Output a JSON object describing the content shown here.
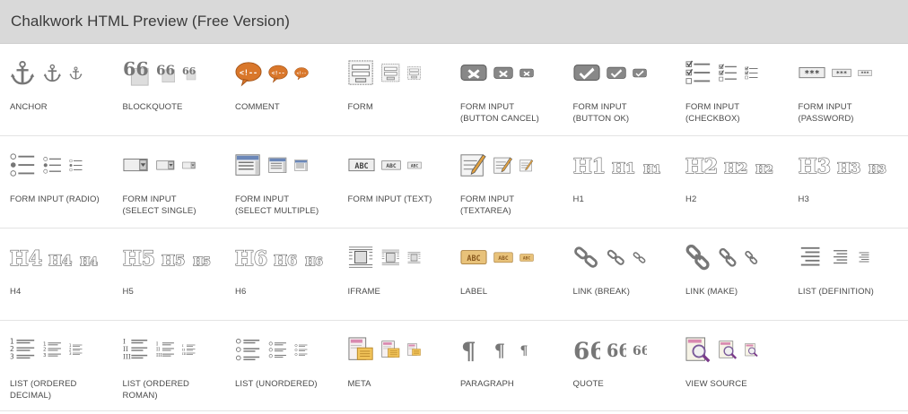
{
  "window": {
    "title": "Chalkwork HTML Preview (Free Version)"
  },
  "rows": [
    [
      {
        "label": "ANCHOR",
        "icon": "anchor-icon"
      },
      {
        "label": "BLOCKQUOTE",
        "icon": "blockquote-icon"
      },
      {
        "label": "COMMENT",
        "icon": "comment-icon"
      },
      {
        "label": "FORM",
        "icon": "form-icon"
      },
      {
        "label": "FORM INPUT\n(BUTTON CANCEL)",
        "icon": "button-cancel-icon"
      },
      {
        "label": "FORM INPUT\n(BUTTON OK)",
        "icon": "button-ok-icon"
      },
      {
        "label": "FORM INPUT\n(CHECKBOX)",
        "icon": "checkbox-icon"
      },
      {
        "label": "FORM INPUT\n(PASSWORD)",
        "icon": "password-icon"
      }
    ],
    [
      {
        "label": "FORM INPUT (RADIO)",
        "icon": "radio-icon"
      },
      {
        "label": "FORM INPUT\n(SELECT SINGLE)",
        "icon": "select-single-icon"
      },
      {
        "label": "FORM INPUT\n(SELECT MULTIPLE)",
        "icon": "select-multiple-icon"
      },
      {
        "label": "FORM INPUT (TEXT)",
        "icon": "text-input-icon"
      },
      {
        "label": "FORM INPUT\n(TEXTAREA)",
        "icon": "textarea-icon"
      },
      {
        "label": "H1",
        "icon": "h1-icon"
      },
      {
        "label": "H2",
        "icon": "h2-icon"
      },
      {
        "label": "H3",
        "icon": "h3-icon"
      }
    ],
    [
      {
        "label": "H4",
        "icon": "h4-icon"
      },
      {
        "label": "H5",
        "icon": "h5-icon"
      },
      {
        "label": "H6",
        "icon": "h6-icon"
      },
      {
        "label": "IFRAME",
        "icon": "iframe-icon"
      },
      {
        "label": "LABEL",
        "icon": "label-icon"
      },
      {
        "label": "LINK (BREAK)",
        "icon": "link-break-icon"
      },
      {
        "label": "LINK (MAKE)",
        "icon": "link-make-icon"
      },
      {
        "label": "LIST (DEFINITION)",
        "icon": "list-definition-icon"
      }
    ],
    [
      {
        "label": "LIST (ORDERED\nDECIMAL)",
        "icon": "list-ordered-decimal-icon"
      },
      {
        "label": "LIST (ORDERED\nROMAN)",
        "icon": "list-ordered-roman-icon"
      },
      {
        "label": "LIST (UNORDERED)",
        "icon": "list-unordered-icon"
      },
      {
        "label": "META",
        "icon": "meta-icon"
      },
      {
        "label": "PARAGRAPH",
        "icon": "paragraph-icon"
      },
      {
        "label": "QUOTE",
        "icon": "quote-icon"
      },
      {
        "label": "VIEW SOURCE",
        "icon": "view-source-icon"
      }
    ]
  ],
  "icon_text": {
    "comment": "<!--",
    "password": "***",
    "text_input": "ABC",
    "label": "ABC",
    "h1": "H1",
    "h2": "H2",
    "h3": "H3",
    "h4": "H4",
    "h5": "H5",
    "h6": "H6"
  },
  "colors": {
    "header_bg": "#d9d9d9",
    "icon_gray": "#7a7a7a",
    "comment_orange": "#d9772b",
    "label_gold": "#e8c27a",
    "meta_pink": "#d98ab0"
  }
}
